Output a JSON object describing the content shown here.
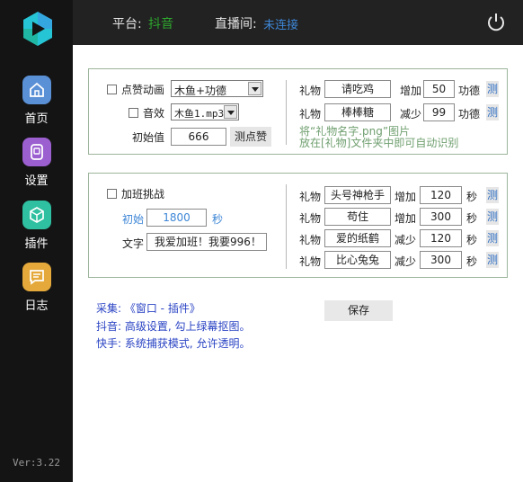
{
  "sidebar": {
    "items": [
      {
        "label": "首页",
        "color": "#5a90d6"
      },
      {
        "label": "设置",
        "color": "#9b5fd0"
      },
      {
        "label": "插件",
        "color": "#2ec0a0"
      },
      {
        "label": "日志",
        "color": "#e4a93a"
      }
    ],
    "version": "Ver:3.22"
  },
  "header": {
    "platform_label": "平台:",
    "platform_value": "抖音",
    "live_label": "直播间:",
    "live_value": "未连接"
  },
  "gift_panel": {
    "like_anim_label": "点赞动画",
    "like_anim_select": "木鱼+功德",
    "sound_label": "音效",
    "sound_select": "木鱼1.mp3",
    "init_label": "初始值",
    "init_value": "666",
    "test_like_button": "测点赞",
    "rows": [
      {
        "gift_label": "礼物",
        "gift": "请吃鸡",
        "action": "增加",
        "amount": "50",
        "unit": "功德",
        "test": "测"
      },
      {
        "gift_label": "礼物",
        "gift": "棒棒糖",
        "action": "减少",
        "amount": "99",
        "unit": "功德",
        "test": "测"
      }
    ],
    "hint_line1": "将“礼物名字.png”图片",
    "hint_line2": "放在[礼物]文件夹中即可自动识别"
  },
  "overtime_panel": {
    "challenge_label": "加班挑战",
    "init_label": "初始",
    "init_value": "1800",
    "init_unit": "秒",
    "text_label": "文字",
    "text_value": "我爱加班！我要996！",
    "rows": [
      {
        "gift_label": "礼物",
        "gift": "头号神枪手",
        "action": "增加",
        "amount": "120",
        "unit": "秒",
        "test": "测"
      },
      {
        "gift_label": "礼物",
        "gift": "苟住",
        "action": "增加",
        "amount": "300",
        "unit": "秒",
        "test": "测"
      },
      {
        "gift_label": "礼物",
        "gift": "爱的纸鹤",
        "action": "减少",
        "amount": "120",
        "unit": "秒",
        "test": "测"
      },
      {
        "gift_label": "礼物",
        "gift": "比心兔兔",
        "action": "减少",
        "amount": "300",
        "unit": "秒",
        "test": "测"
      }
    ]
  },
  "notes": {
    "line1": "采集: 《窗口 - 插件》",
    "line2": "抖音: 高级设置, 勾上绿幕抠图。",
    "line3": "快手: 系统捕获模式, 允许透明。"
  },
  "save_button": "保存"
}
